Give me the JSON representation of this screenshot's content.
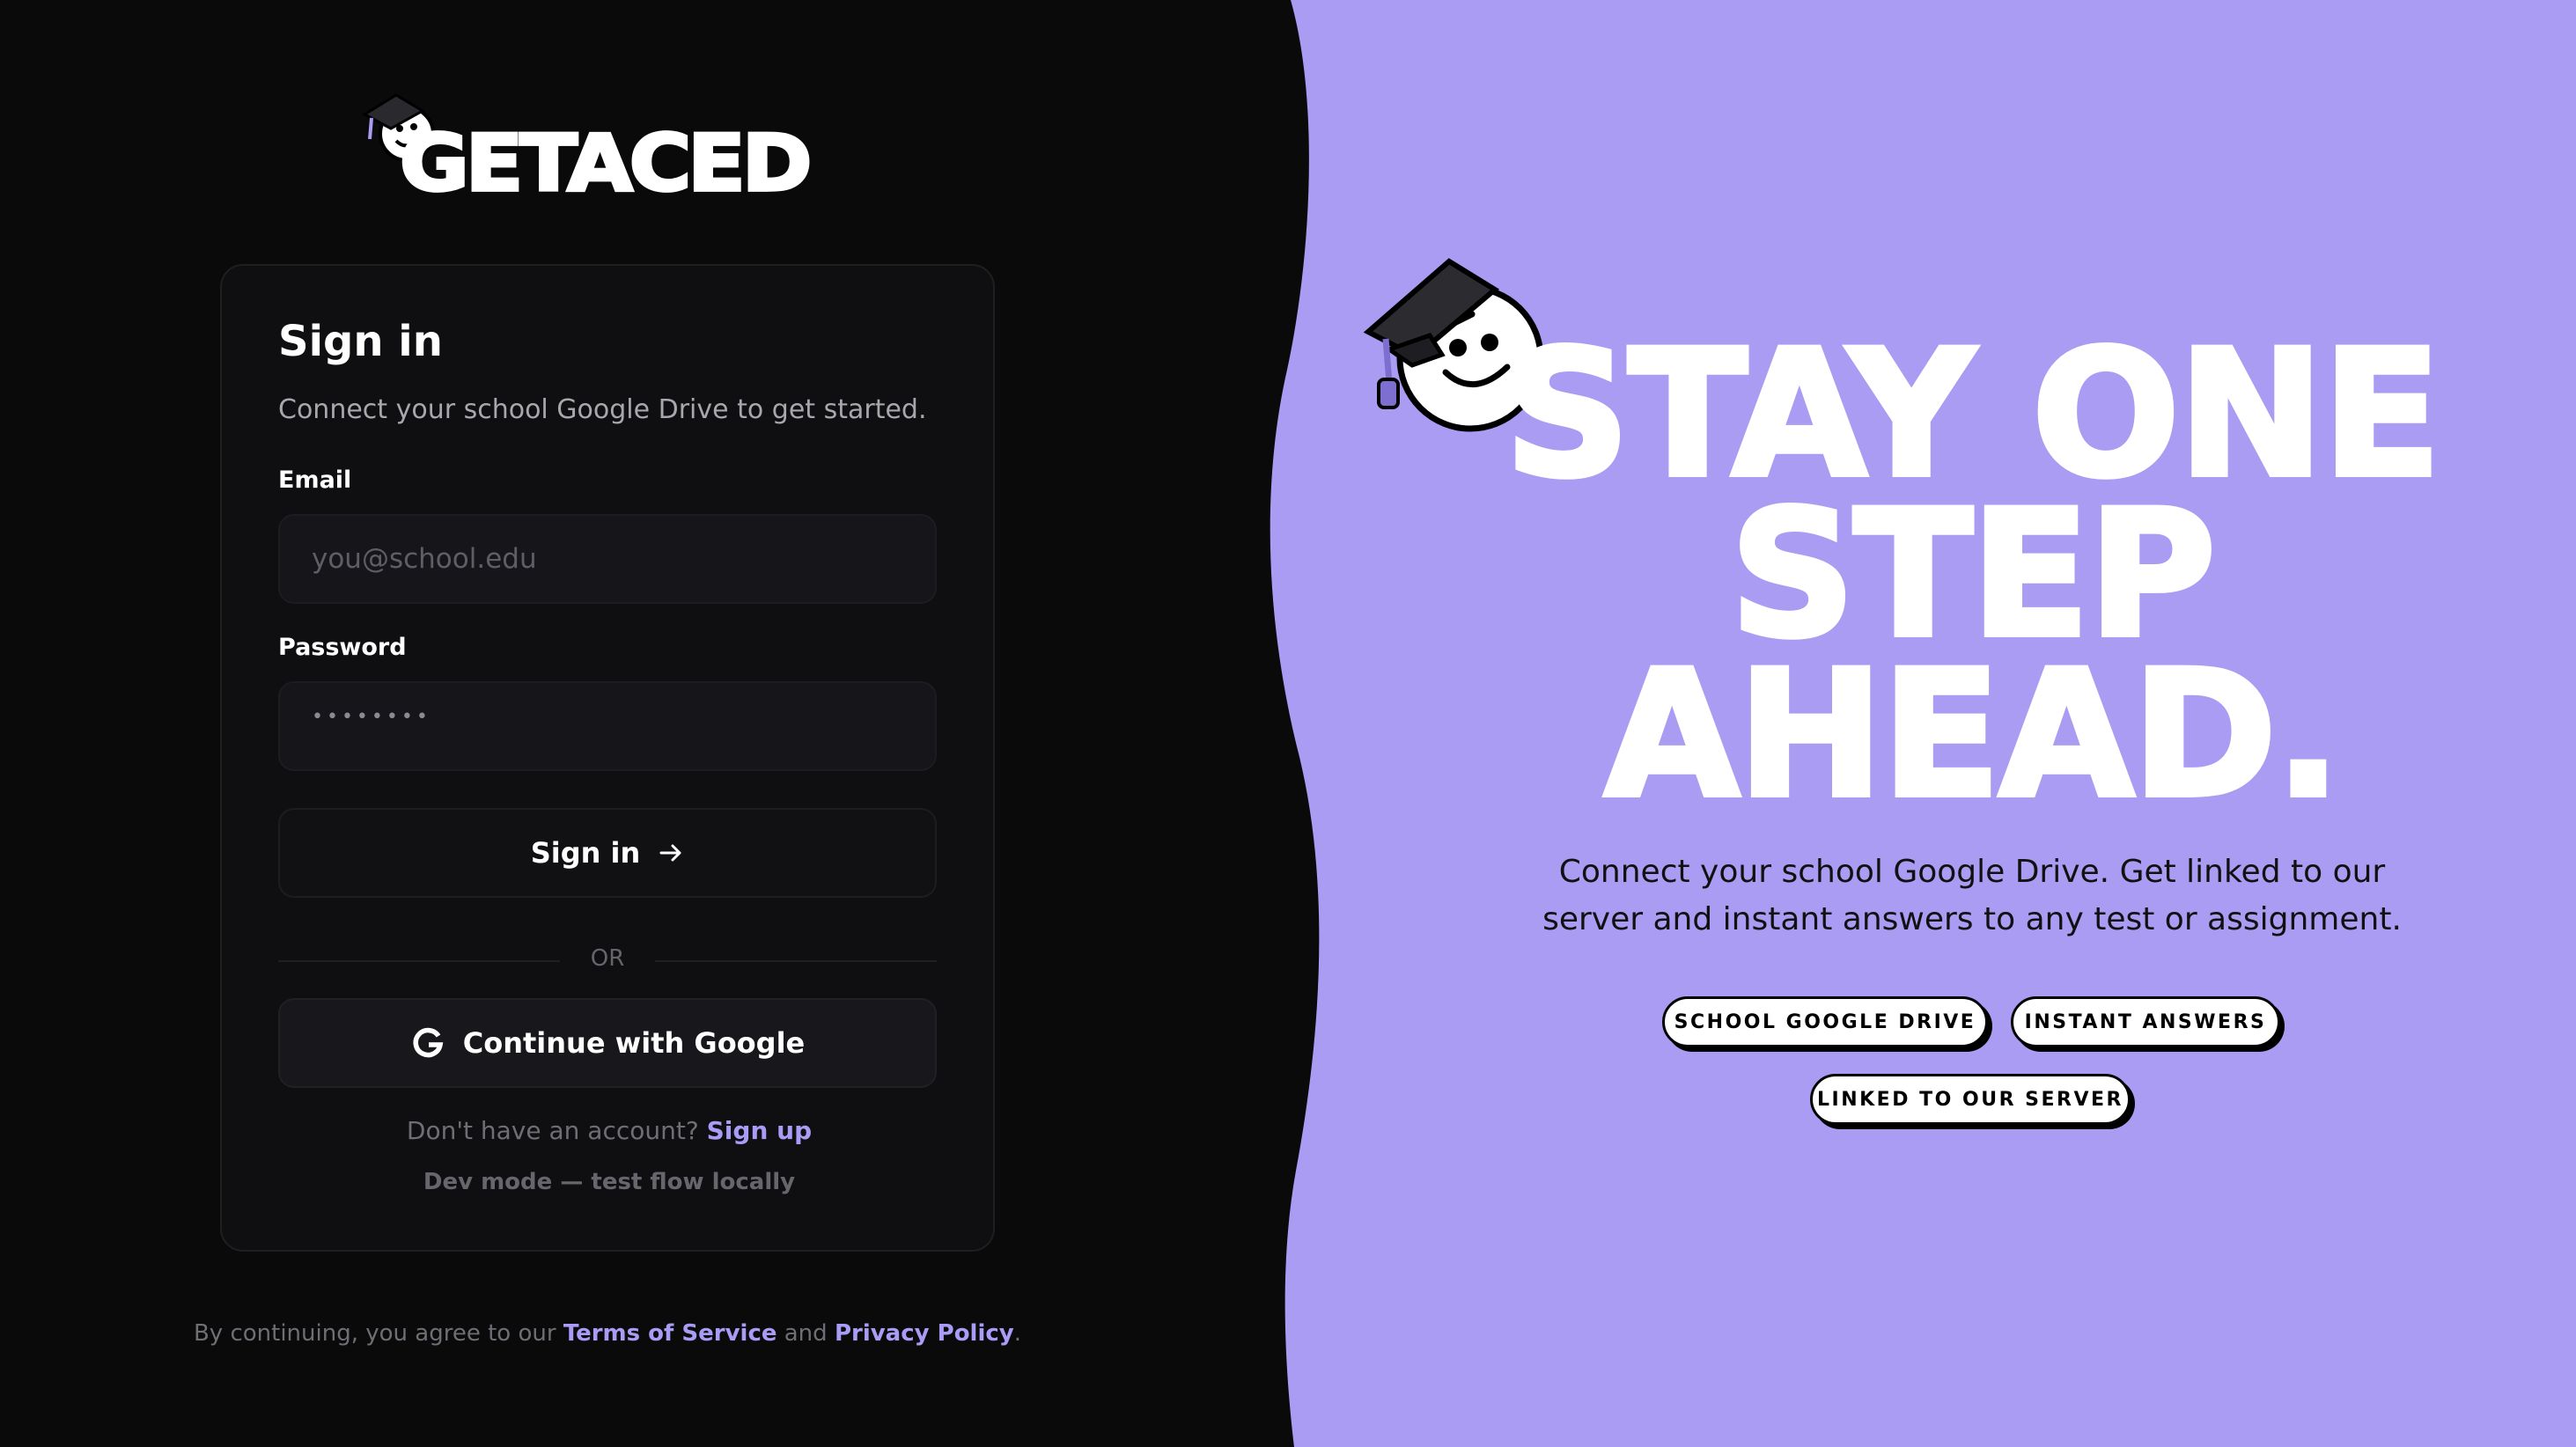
{
  "brand": {
    "name": "GETACED"
  },
  "signin": {
    "title": "Sign in",
    "subtitle": "Connect your school Google Drive to get started.",
    "email_label": "Email",
    "email_placeholder": "you@school.edu",
    "password_label": "Password",
    "password_value": "••••••••",
    "submit_label": "Sign in",
    "divider_text": "OR",
    "google_label": "Continue with Google",
    "no_account_text": "Don't have an account?",
    "signup_label": "Sign up",
    "dev_mode_label": "Dev mode — test flow locally"
  },
  "legal": {
    "prefix": "By continuing, you agree to our",
    "terms_label": "Terms of Service",
    "and_text": "and",
    "privacy_label": "Privacy Policy",
    "suffix": "."
  },
  "hero": {
    "headline_line1": "STAY ONE",
    "headline_line2": "STEP",
    "headline_line3": "AHEAD.",
    "tagline_line1": "Connect your school Google Drive. Get linked to our",
    "tagline_line2": "server and instant answers to any test or assignment.",
    "chips": [
      "SCHOOL GOOGLE DRIVE",
      "INSTANT ANSWERS",
      "LINKED TO OUR SERVER"
    ]
  },
  "colors": {
    "left_bg": "#0a0a0b",
    "right_bg": "#aa9cf3",
    "accent_link": "#a99cf6",
    "card_bg": "#0f0f11"
  },
  "icons": {
    "logo_mascot": "graduate-smiley-icon",
    "submit_arrow": "arrow-right-icon",
    "google": "google-g-icon",
    "hero_mascot": "graduate-smiley-icon"
  }
}
